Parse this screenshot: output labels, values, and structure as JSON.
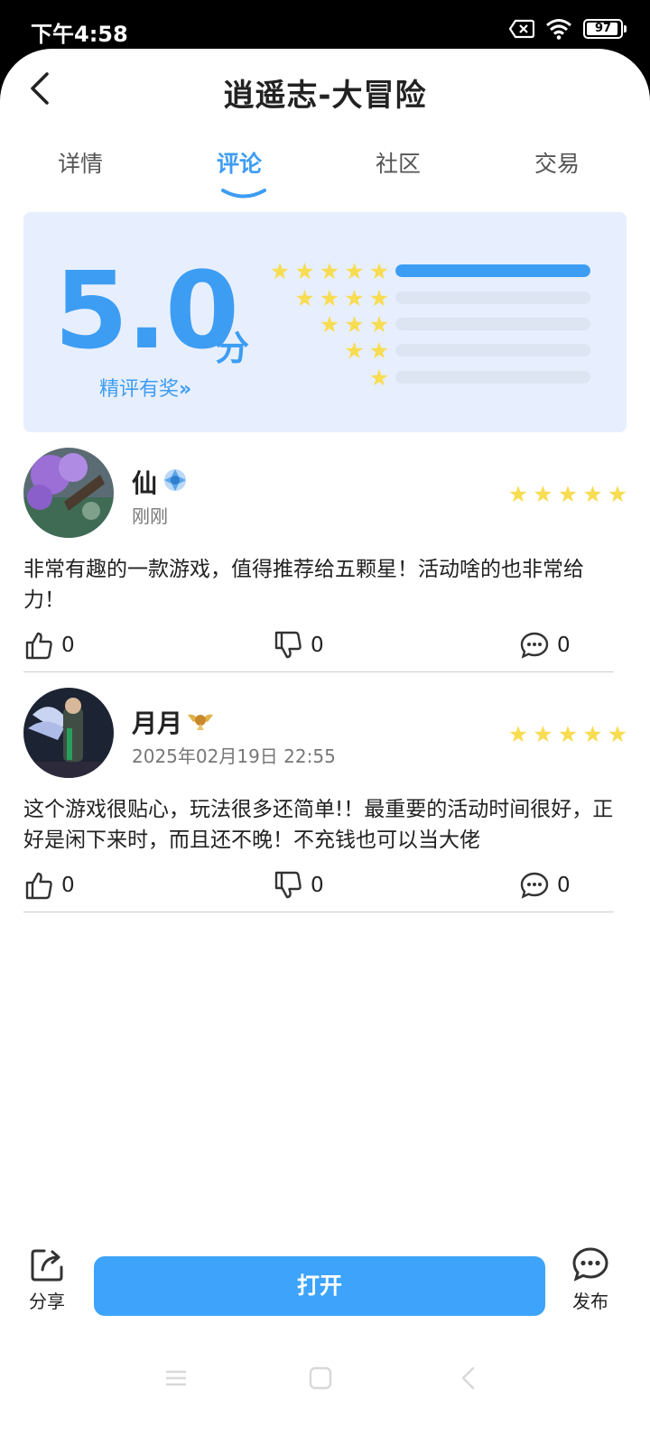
{
  "status_bar": {
    "time": "下午4:58",
    "battery": "97",
    "icons": [
      "sim-x-icon",
      "wifi-icon",
      "battery-icon"
    ]
  },
  "header": {
    "title": "逍遥志-大冒险",
    "back_icon": "chevron-left-icon"
  },
  "tabs": [
    {
      "label": "详情",
      "active": false
    },
    {
      "label": "评论",
      "active": true
    },
    {
      "label": "社区",
      "active": false
    },
    {
      "label": "交易",
      "active": false
    }
  ],
  "rating": {
    "score": "5.0",
    "unit": "分",
    "reward_link": "精评有奖",
    "distribution": [
      {
        "stars": 5,
        "fraction": 1.0
      },
      {
        "stars": 4,
        "fraction": 0
      },
      {
        "stars": 3,
        "fraction": 0
      },
      {
        "stars": 2,
        "fraction": 0
      },
      {
        "stars": 1,
        "fraction": 0
      }
    ]
  },
  "reviews": [
    {
      "username": "仙",
      "badge": "blue-crystal-badge-icon",
      "time": "刚刚",
      "stars": 5,
      "text": "非常有趣的一款游戏，值得推荐给五颗星！活动啥的也非常给力！",
      "likes": "0",
      "dislikes": "0",
      "comments": "0"
    },
    {
      "username": "月月",
      "badge": "gold-wings-badge-icon",
      "time": "2025年02月19日 22:55",
      "stars": 5,
      "text": "这个游戏很贴心，玩法很多还简单!！最重要的活动时间很好，正好是闲下来时，而且还不晚！不充钱也可以当大佬",
      "likes": "0",
      "dislikes": "0",
      "comments": "0"
    }
  ],
  "bottom_bar": {
    "share_label": "分享",
    "open_label": "打开",
    "publish_label": "发布"
  },
  "nav_bar": {
    "icons": [
      "menu-icon",
      "home-icon",
      "back-icon"
    ]
  },
  "colors": {
    "accent": "#3d9df3",
    "star": "#f8dc52",
    "card_bg": "#e7effe"
  }
}
